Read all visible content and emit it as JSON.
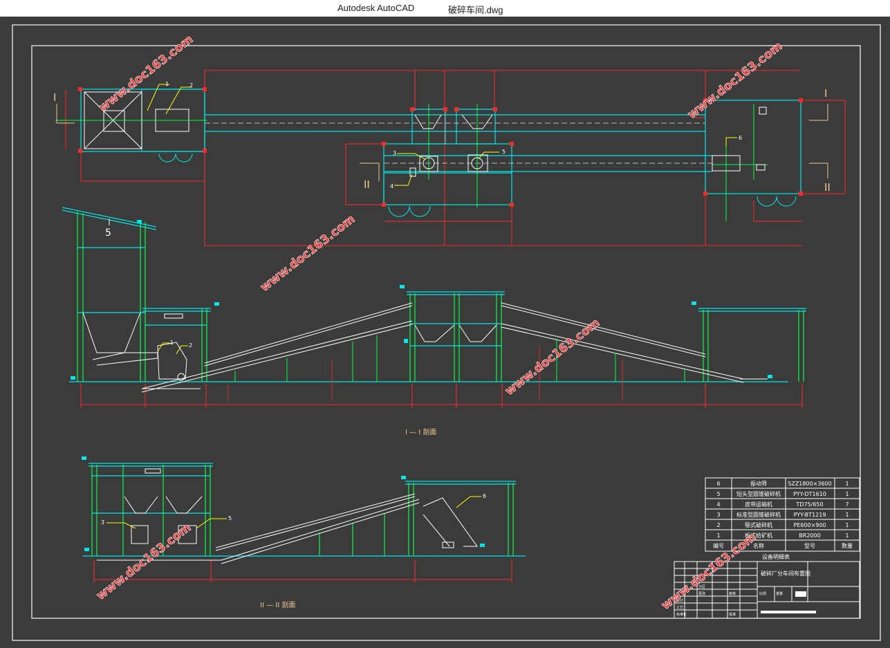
{
  "window": {
    "app_title": "Autodesk AutoCAD",
    "file_name": "破碎车间.dwg"
  },
  "colors": {
    "background": "#3b3b3b",
    "frame": "#ffffff",
    "structure": "#00e5e5",
    "dimension": "#ff2a2a",
    "equipment": "#00ff44",
    "leader": "#ffff00",
    "label": "#f0c890",
    "watermark": "#ff3b3b"
  },
  "drawing": {
    "section_markers": {
      "i_left": "I",
      "i_right": "I",
      "ii_left": "II",
      "ii_right": "II",
      "hook_number": "5"
    },
    "plan_callouts": [
      "1",
      "2",
      "3",
      "4",
      "5",
      "6"
    ],
    "section1_callouts": [
      "1",
      "2"
    ],
    "section2_callouts": [
      "3",
      "5",
      "6"
    ],
    "section1_title": "I — I 剖面",
    "section2_title": "II — II 剖面",
    "watermark": "www.doc163.com"
  },
  "equipment_table": {
    "title": "设备明细表",
    "headers": [
      "编号",
      "名称",
      "型号",
      "数量"
    ],
    "rows": [
      {
        "no": "6",
        "name": "振动筛",
        "model": "SZZ1800×3600",
        "qty": "1"
      },
      {
        "no": "5",
        "name": "短头型圆锥破碎机",
        "model": "PYY-DT1610",
        "qty": "1"
      },
      {
        "no": "4",
        "name": "皮带运输机",
        "model": "TD75/650",
        "qty": "7"
      },
      {
        "no": "3",
        "name": "标准型圆锥破碎机",
        "model": "PYY-BT1219",
        "qty": "1"
      },
      {
        "no": "2",
        "name": "颚式破碎机",
        "model": "PE600×900",
        "qty": "1"
      },
      {
        "no": "1",
        "name": "板式给矿机",
        "model": "BR2000",
        "qty": "1"
      }
    ]
  },
  "title_block": {
    "drawing_title": "破碎厂分车间布置图",
    "cells": [
      "分区",
      "更改",
      "设计",
      "审核",
      "工艺",
      "标准化",
      "批准",
      "比例",
      "重量"
    ]
  }
}
